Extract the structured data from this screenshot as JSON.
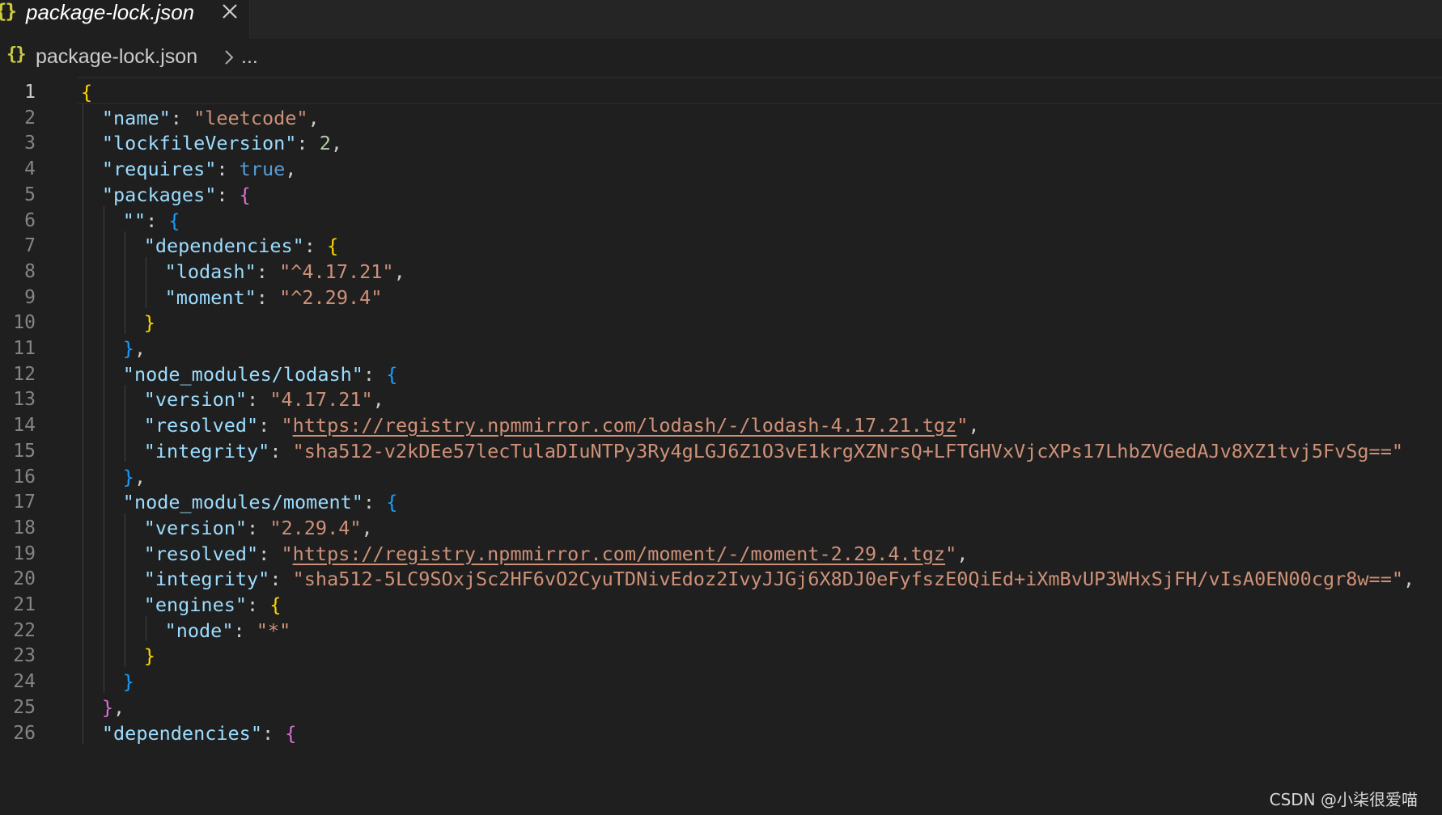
{
  "tab": {
    "icon_text": "{}",
    "title": "package-lock.json"
  },
  "breadcrumb": {
    "icon_text": "{}",
    "file": "package-lock.json",
    "more": "..."
  },
  "editor": {
    "active_line": 1,
    "lines": [
      {
        "n": "1",
        "indent": 0,
        "tokens": [
          [
            "b1",
            "{"
          ]
        ]
      },
      {
        "n": "2",
        "indent": 1,
        "tokens": [
          [
            "k",
            "\"name\""
          ],
          [
            "p",
            ": "
          ],
          [
            "s",
            "\"leetcode\""
          ],
          [
            "p",
            ","
          ]
        ]
      },
      {
        "n": "3",
        "indent": 1,
        "tokens": [
          [
            "k",
            "\"lockfileVersion\""
          ],
          [
            "p",
            ": "
          ],
          [
            "n",
            "2"
          ],
          [
            "p",
            ","
          ]
        ]
      },
      {
        "n": "4",
        "indent": 1,
        "tokens": [
          [
            "k",
            "\"requires\""
          ],
          [
            "p",
            ": "
          ],
          [
            "b",
            "true"
          ],
          [
            "p",
            ","
          ]
        ]
      },
      {
        "n": "5",
        "indent": 1,
        "tokens": [
          [
            "k",
            "\"packages\""
          ],
          [
            "p",
            ": "
          ],
          [
            "b2",
            "{"
          ]
        ]
      },
      {
        "n": "6",
        "indent": 2,
        "tokens": [
          [
            "k",
            "\"\""
          ],
          [
            "p",
            ": "
          ],
          [
            "b3",
            "{"
          ]
        ]
      },
      {
        "n": "7",
        "indent": 3,
        "tokens": [
          [
            "k",
            "\"dependencies\""
          ],
          [
            "p",
            ": "
          ],
          [
            "b1",
            "{"
          ]
        ]
      },
      {
        "n": "8",
        "indent": 4,
        "tokens": [
          [
            "k",
            "\"lodash\""
          ],
          [
            "p",
            ": "
          ],
          [
            "s",
            "\"^4.17.21\""
          ],
          [
            "p",
            ","
          ]
        ]
      },
      {
        "n": "9",
        "indent": 4,
        "tokens": [
          [
            "k",
            "\"moment\""
          ],
          [
            "p",
            ": "
          ],
          [
            "s",
            "\"^2.29.4\""
          ]
        ]
      },
      {
        "n": "10",
        "indent": 3,
        "tokens": [
          [
            "b1",
            "}"
          ]
        ]
      },
      {
        "n": "11",
        "indent": 2,
        "tokens": [
          [
            "b3",
            "}"
          ],
          [
            "p",
            ","
          ]
        ]
      },
      {
        "n": "12",
        "indent": 2,
        "tokens": [
          [
            "k",
            "\"node_modules/lodash\""
          ],
          [
            "p",
            ": "
          ],
          [
            "b3",
            "{"
          ]
        ]
      },
      {
        "n": "13",
        "indent": 3,
        "tokens": [
          [
            "k",
            "\"version\""
          ],
          [
            "p",
            ": "
          ],
          [
            "s",
            "\"4.17.21\""
          ],
          [
            "p",
            ","
          ]
        ]
      },
      {
        "n": "14",
        "indent": 3,
        "tokens": [
          [
            "k",
            "\"resolved\""
          ],
          [
            "p",
            ": "
          ],
          [
            "s",
            "\""
          ],
          [
            "u",
            "https://registry.npmmirror.com/lodash/-/lodash-4.17.21.tgz"
          ],
          [
            "s",
            "\""
          ],
          [
            "p",
            ","
          ]
        ]
      },
      {
        "n": "15",
        "indent": 3,
        "tokens": [
          [
            "k",
            "\"integrity\""
          ],
          [
            "p",
            ": "
          ],
          [
            "s",
            "\"sha512-v2kDEe57lecTulaDIuNTPy3Ry4gLGJ6Z1O3vE1krgXZNrsQ+LFTGHVxVjcXPs17LhbZVGedAJv8XZ1tvj5FvSg==\""
          ]
        ]
      },
      {
        "n": "16",
        "indent": 2,
        "tokens": [
          [
            "b3",
            "}"
          ],
          [
            "p",
            ","
          ]
        ]
      },
      {
        "n": "17",
        "indent": 2,
        "tokens": [
          [
            "k",
            "\"node_modules/moment\""
          ],
          [
            "p",
            ": "
          ],
          [
            "b3",
            "{"
          ]
        ]
      },
      {
        "n": "18",
        "indent": 3,
        "tokens": [
          [
            "k",
            "\"version\""
          ],
          [
            "p",
            ": "
          ],
          [
            "s",
            "\"2.29.4\""
          ],
          [
            "p",
            ","
          ]
        ]
      },
      {
        "n": "19",
        "indent": 3,
        "tokens": [
          [
            "k",
            "\"resolved\""
          ],
          [
            "p",
            ": "
          ],
          [
            "s",
            "\""
          ],
          [
            "u",
            "https://registry.npmmirror.com/moment/-/moment-2.29.4.tgz"
          ],
          [
            "s",
            "\""
          ],
          [
            "p",
            ","
          ]
        ]
      },
      {
        "n": "20",
        "indent": 3,
        "tokens": [
          [
            "k",
            "\"integrity\""
          ],
          [
            "p",
            ": "
          ],
          [
            "s",
            "\"sha512-5LC9SOxjSc2HF6vO2CyuTDNivEdoz2IvyJJGj6X8DJ0eFyfszE0QiEd+iXmBvUP3WHxSjFH/vIsA0EN00cgr8w==\""
          ],
          [
            "p",
            ","
          ]
        ]
      },
      {
        "n": "21",
        "indent": 3,
        "tokens": [
          [
            "k",
            "\"engines\""
          ],
          [
            "p",
            ": "
          ],
          [
            "b1",
            "{"
          ]
        ]
      },
      {
        "n": "22",
        "indent": 4,
        "tokens": [
          [
            "k",
            "\"node\""
          ],
          [
            "p",
            ": "
          ],
          [
            "s",
            "\"*\""
          ]
        ]
      },
      {
        "n": "23",
        "indent": 3,
        "tokens": [
          [
            "b1",
            "}"
          ]
        ]
      },
      {
        "n": "24",
        "indent": 2,
        "tokens": [
          [
            "b3",
            "}"
          ]
        ]
      },
      {
        "n": "25",
        "indent": 1,
        "tokens": [
          [
            "b2",
            "}"
          ],
          [
            "p",
            ","
          ]
        ]
      },
      {
        "n": "26",
        "indent": 1,
        "tokens": [
          [
            "k",
            "\"dependencies\""
          ],
          [
            "p",
            ": "
          ],
          [
            "b2",
            "{"
          ]
        ]
      }
    ]
  },
  "watermark": "CSDN @小柒很爱喵"
}
